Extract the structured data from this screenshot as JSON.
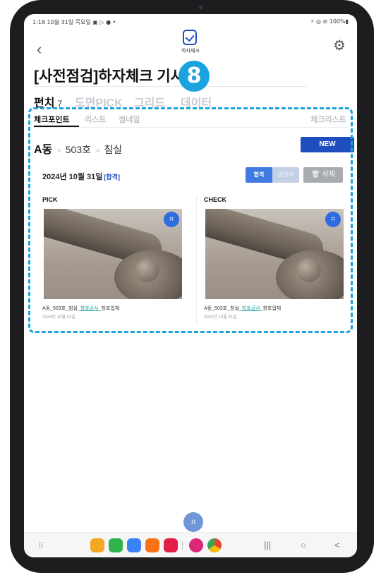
{
  "status_bar": {
    "left": "1:18  10월 31일 목요일  ▣ ▷ ● •",
    "right": "⚡ ◎ ⊘ 100%▮"
  },
  "app_bar": {
    "back_icon": "chevron-left-icon",
    "logo_text": "하자체크",
    "settings_icon": "gear-icon"
  },
  "page": {
    "title": "[사전점검]하자체크 기사",
    "step_badge": "8"
  },
  "tabs": [
    {
      "label": "펀치",
      "count": "7",
      "active": true
    },
    {
      "label": "도면PICK",
      "active": false
    },
    {
      "label": "그리드",
      "active": false
    },
    {
      "label": "데이터",
      "active": false
    }
  ],
  "sub_tabs": {
    "items": [
      "체크포인트",
      "리스트",
      "썸네일"
    ],
    "right": "체크리스트"
  },
  "breadcrumb": {
    "building": "A동",
    "unit": "503호",
    "room": "침실",
    "separator": ">"
  },
  "new_button": "NEW",
  "record": {
    "date": "2024년 10월 31일",
    "status": "[합격]",
    "pass_button": "합격",
    "fail_button": "불합격",
    "delete_button": "삭제"
  },
  "cards": [
    {
      "label": "PICK",
      "caption_prefix": "A동_503호_침실_",
      "caption_highlight": "창호공사",
      "caption_suffix": "_창호업체",
      "date": "2024년 10월 31일"
    },
    {
      "label": "CHECK",
      "caption_prefix": "A동_503호_침실_",
      "caption_highlight": "창호공사",
      "caption_suffix": "_창호업체",
      "date": "2024년 10월 31일"
    }
  ],
  "colors": {
    "accent": "#1f4fbf",
    "highlight": "#1aa3de",
    "pass": "#3f7be0"
  },
  "nav": {
    "recent": "|||",
    "home": "○",
    "back": "<"
  }
}
